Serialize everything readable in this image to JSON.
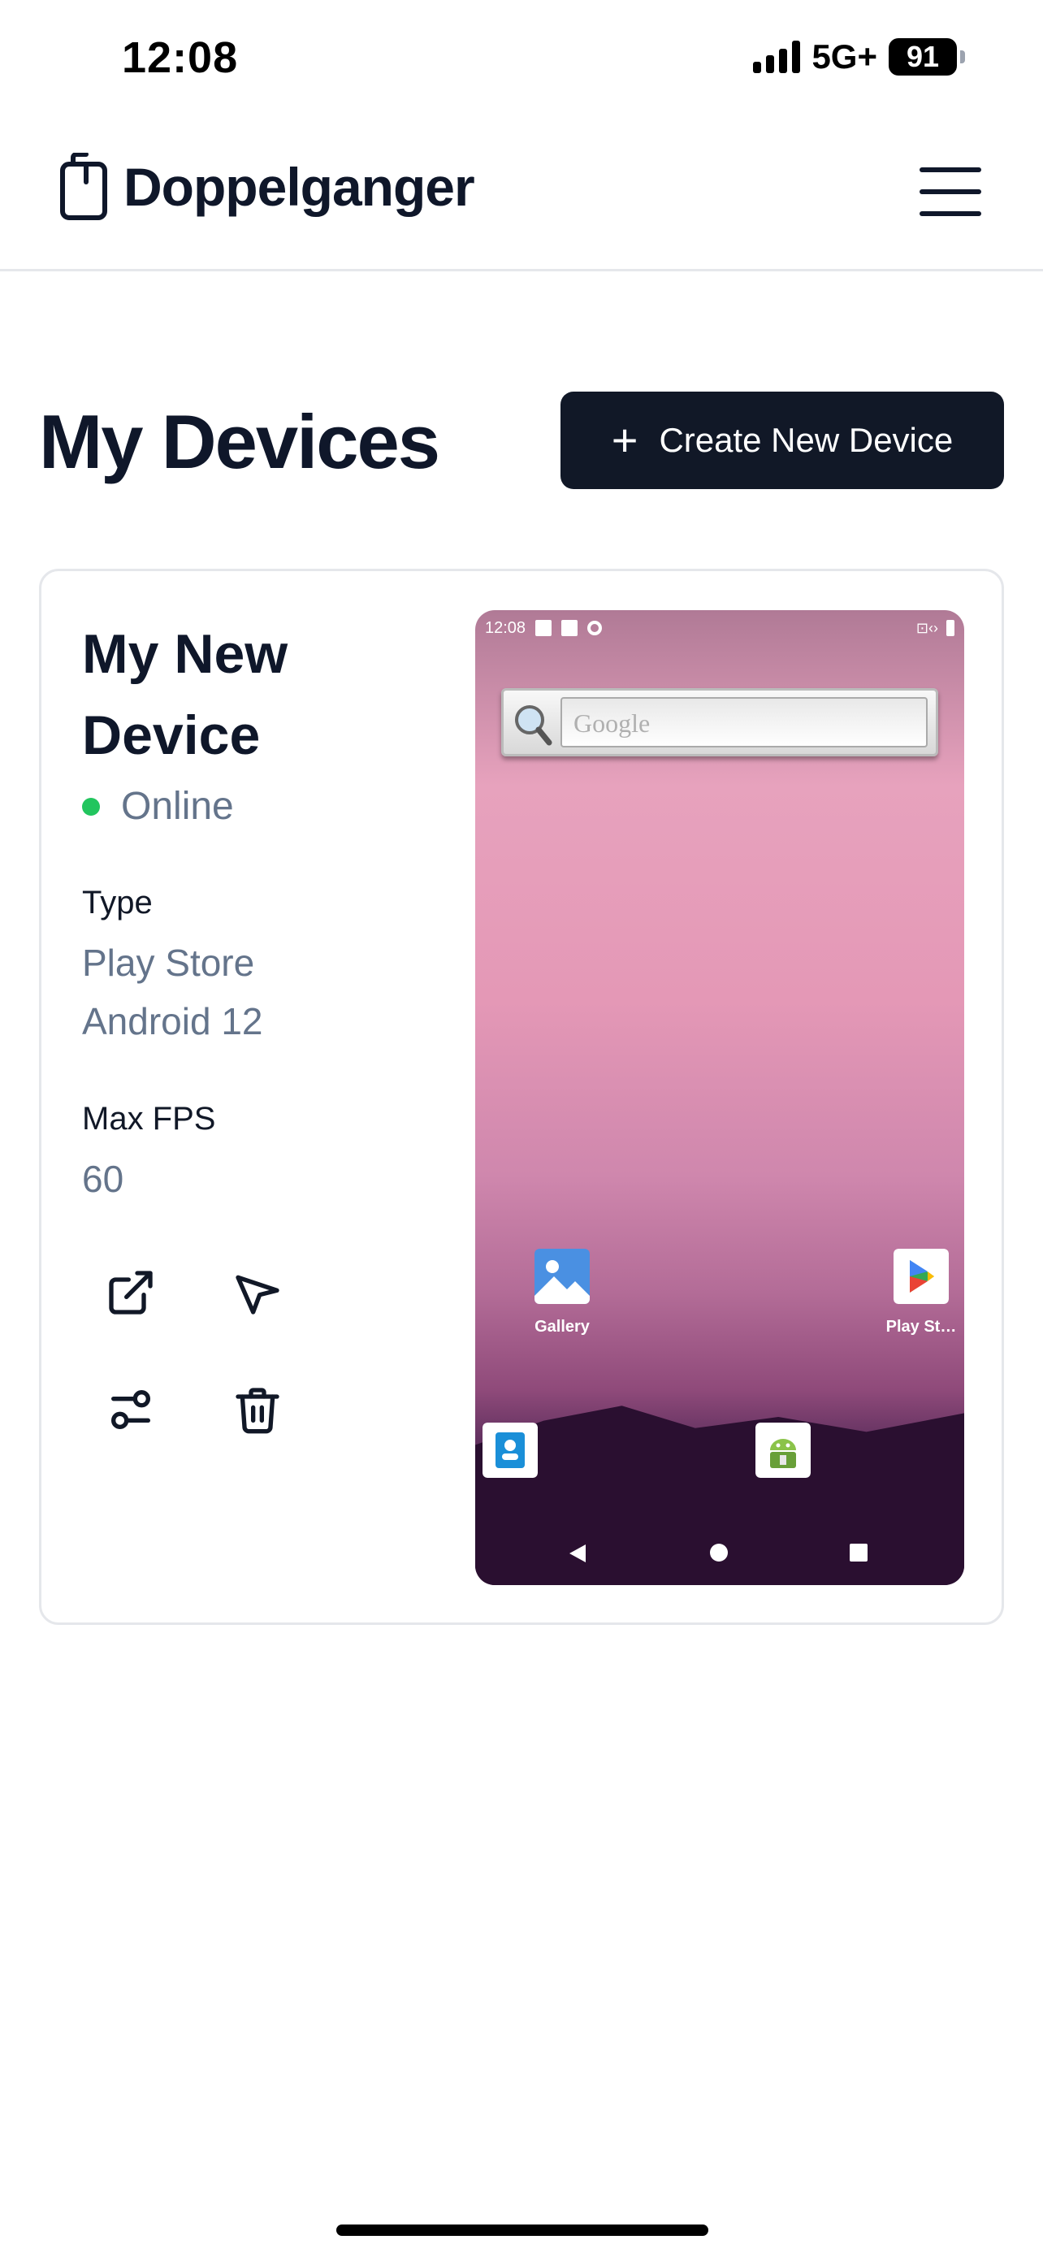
{
  "status_bar": {
    "time": "12:08",
    "network": "5G+",
    "battery": "91"
  },
  "header": {
    "app_name": "Doppelganger"
  },
  "page": {
    "title": "My Devices",
    "create_button": "Create New Device"
  },
  "device": {
    "name": "My New Device",
    "status": "Online",
    "type_label": "Type",
    "type_value_line1": "Play Store",
    "type_value_line2": "Android 12",
    "fps_label": "Max FPS",
    "fps_value": "60",
    "status_color": "#22c55e"
  },
  "preview": {
    "time": "12:08",
    "search_placeholder": "Google",
    "apps": [
      {
        "label": "Gallery",
        "icon": "gallery-icon"
      },
      {
        "label": "Play St…",
        "icon": "play-store-icon"
      },
      {
        "label": "",
        "icon": "contacts-icon"
      },
      {
        "label": "",
        "icon": "android-icon"
      }
    ]
  },
  "colors": {
    "primary_dark": "#111827",
    "muted": "#64748b",
    "border": "#e5e7eb"
  }
}
